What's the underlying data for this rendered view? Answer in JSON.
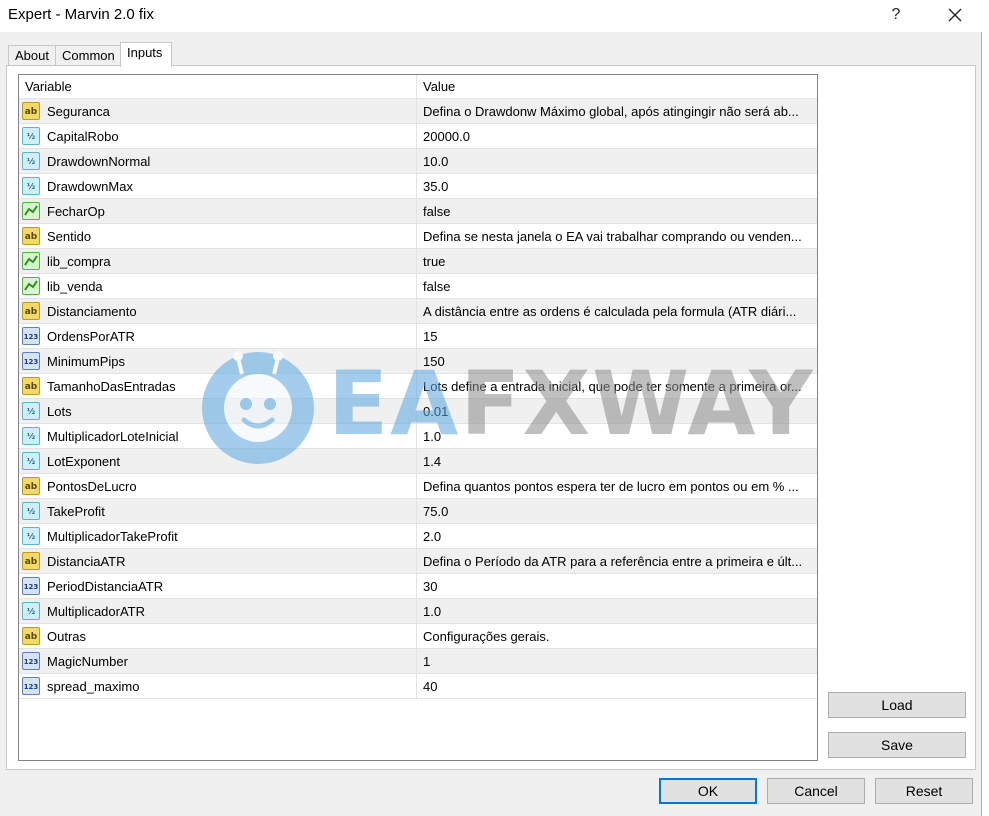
{
  "window": {
    "title": "Expert - Marvin 2.0 fix",
    "help_label": "?"
  },
  "tabs": [
    {
      "label": "About"
    },
    {
      "label": "Common"
    },
    {
      "label": "Inputs"
    }
  ],
  "grid": {
    "headers": {
      "variable": "Variable",
      "value": "Value"
    },
    "rows": [
      {
        "type": "ab",
        "name": "Seguranca",
        "value": "Defina o Drawdonw Máximo global, após atingingir não será ab..."
      },
      {
        "type": "half",
        "name": "CapitalRobo",
        "value": "20000.0"
      },
      {
        "type": "half",
        "name": "DrawdownNormal",
        "value": "10.0"
      },
      {
        "type": "half",
        "name": "DrawdownMax",
        "value": "35.0"
      },
      {
        "type": "bool",
        "name": "FecharOp",
        "value": "false"
      },
      {
        "type": "ab",
        "name": "Sentido",
        "value": "Defina se nesta janela o EA vai trabalhar comprando ou venden..."
      },
      {
        "type": "bool",
        "name": "lib_compra",
        "value": "true"
      },
      {
        "type": "bool",
        "name": "lib_venda",
        "value": "false"
      },
      {
        "type": "ab",
        "name": "Distanciamento",
        "value": "A distância entre as ordens é calculada pela formula (ATR diári..."
      },
      {
        "type": "int",
        "name": "OrdensPorATR",
        "value": "15"
      },
      {
        "type": "int",
        "name": "MinimumPips",
        "value": "150"
      },
      {
        "type": "ab",
        "name": "TamanhoDasEntradas",
        "value": "Lots define a entrada inicial, que pode ter somente a primeira or..."
      },
      {
        "type": "half",
        "name": "Lots",
        "value": "0.01"
      },
      {
        "type": "half",
        "name": "MultiplicadorLoteInicial",
        "value": "1.0"
      },
      {
        "type": "half",
        "name": "LotExponent",
        "value": "1.4"
      },
      {
        "type": "ab",
        "name": "PontosDeLucro",
        "value": "Defina quantos pontos espera ter de lucro em pontos ou em % ..."
      },
      {
        "type": "half",
        "name": "TakeProfit",
        "value": "75.0"
      },
      {
        "type": "half",
        "name": "MultiplicadorTakeProfit",
        "value": "2.0"
      },
      {
        "type": "ab",
        "name": "DistanciaATR",
        "value": "Defina o Período da ATR para a referência entre a primeira e últ..."
      },
      {
        "type": "int",
        "name": "PeriodDistanciaATR",
        "value": "30"
      },
      {
        "type": "half",
        "name": "MultiplicadorATR",
        "value": "1.0"
      },
      {
        "type": "ab",
        "name": "Outras",
        "value": "Configurações gerais."
      },
      {
        "type": "int",
        "name": "MagicNumber",
        "value": "1"
      },
      {
        "type": "int",
        "name": "spread_maximo",
        "value": "40"
      }
    ]
  },
  "side_buttons": {
    "load": "Load",
    "save": "Save"
  },
  "footer_buttons": {
    "ok": "OK",
    "cancel": "Cancel",
    "reset": "Reset"
  },
  "icon_glyphs": {
    "ab": "ab",
    "half": "½",
    "int": "123"
  },
  "watermark": {
    "ea": "EA",
    "rest": "FXWAY"
  }
}
